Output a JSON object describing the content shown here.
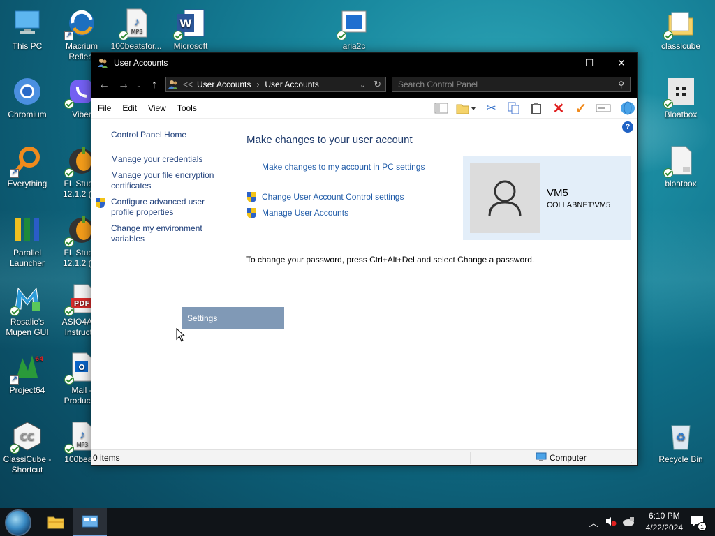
{
  "desktop": {
    "icons": [
      {
        "label": "This PC"
      },
      {
        "label": "Macrium Reflect"
      },
      {
        "label": "100beatsfor..."
      },
      {
        "label": "Microsoft"
      },
      {
        "label": "aria2c"
      },
      {
        "label": "classicube"
      },
      {
        "label": "Chromium"
      },
      {
        "label": "Viber"
      },
      {
        "label": "Bloatbox"
      },
      {
        "label": "Everything"
      },
      {
        "label": "FL Studio 12.1.2 (32"
      },
      {
        "label": "bloatbox"
      },
      {
        "label": "Parallel Launcher"
      },
      {
        "label": "FL Studio 12.1.2 (64"
      },
      {
        "label": "Rosalie's Mupen GUI"
      },
      {
        "label": "ASIO4ALL Instructio"
      },
      {
        "label": "Project64"
      },
      {
        "label": "Mail - Productio"
      },
      {
        "label": "ClassiCube - Shortcut"
      },
      {
        "label": "100beats"
      },
      {
        "label": "Recycle Bin"
      }
    ]
  },
  "window": {
    "title": "User Accounts",
    "min_glyph": "—",
    "max_glyph": "☐",
    "close_glyph": "✕",
    "address": {
      "crumb_sep": "<<",
      "crumbs": [
        "User Accounts",
        "User Accounts"
      ],
      "chevron": "›"
    },
    "search_placeholder": "Search Control Panel",
    "menu": [
      "File",
      "Edit",
      "View",
      "Tools"
    ],
    "left_pane": {
      "home": "Control Panel Home",
      "links": [
        "Manage your credentials",
        "Manage your file encryption certificates",
        "Configure advanced user profile properties",
        "Change my environment variables"
      ]
    },
    "main": {
      "title": "Make changes to your user account",
      "pc_settings_link": "Make changes to my account in PC settings",
      "uac_link": "Change User Account Control settings",
      "manage_link": "Manage User Accounts",
      "password_text": "To change your password, press Ctrl+Alt+Del and select Change a password."
    },
    "user": {
      "name": "VM5",
      "domain": "COLLABNET\\VM5"
    },
    "tooltip": "Settings",
    "status": {
      "items": "0 items",
      "location": "Computer"
    }
  },
  "taskbar": {
    "time": "6:10 PM",
    "date": "4/22/2024",
    "notification_count": "1"
  },
  "colors": {
    "link": "#1f5ba8",
    "title": "#1e3a6b",
    "card": "#e3eef9",
    "tooltip": "#8099b6"
  }
}
